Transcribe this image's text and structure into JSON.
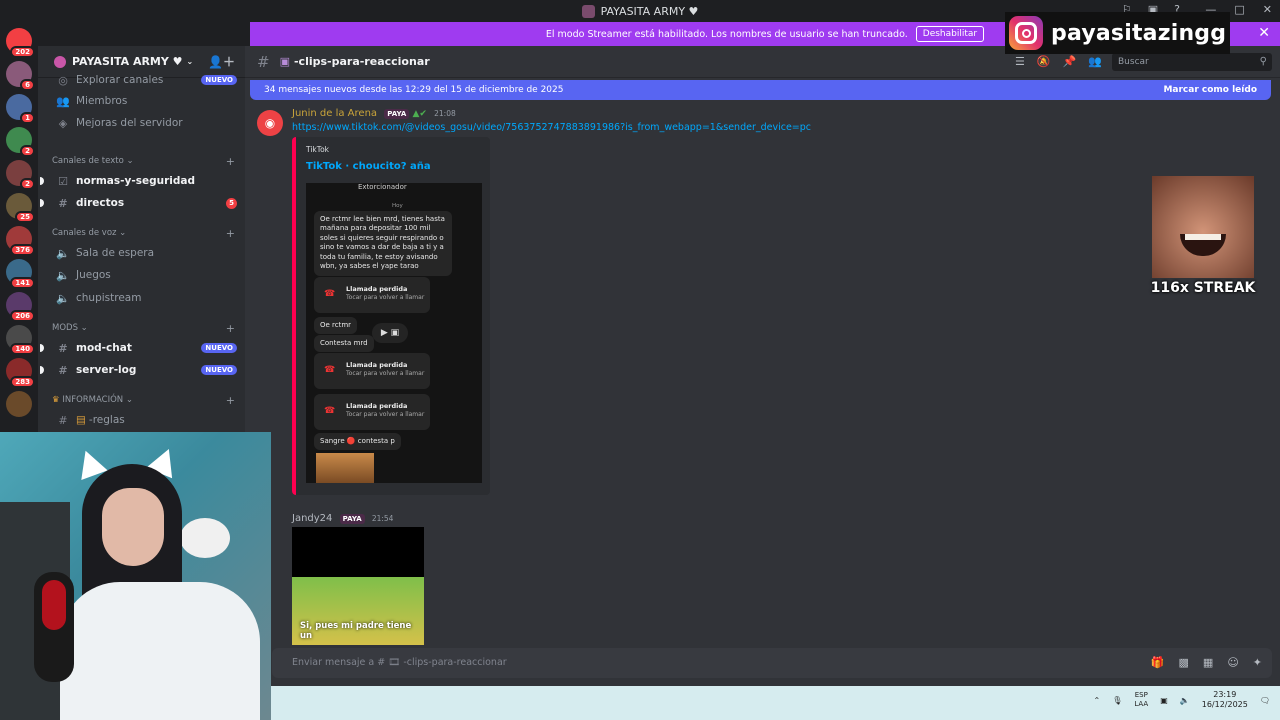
{
  "titlebar": {
    "title": "PAYASITA ARMY ♥",
    "controls": [
      "—",
      "□",
      "✕"
    ]
  },
  "streamer_bar": {
    "text": "El modo Streamer está habilitado. Los nombres de usuario se han truncado.",
    "button": "Deshabilitar",
    "close": "✕"
  },
  "overlay": {
    "handle": "payasitazingg",
    "streak": "116x STREAK"
  },
  "guilds": [
    {
      "badge": "202"
    },
    {
      "badge": "6"
    },
    {
      "badge": "1"
    },
    {
      "badge": "2"
    },
    {
      "badge": "2"
    },
    {
      "badge": "25"
    },
    {
      "badge": "376"
    },
    {
      "badge": "141"
    },
    {
      "badge": "206"
    },
    {
      "badge": "140"
    },
    {
      "badge": "283"
    },
    {
      "badge": ""
    }
  ],
  "server": {
    "name": "PAYASITA ARMY ♥"
  },
  "sidebar": {
    "top_items": [
      {
        "label": "Explorar canales",
        "pill": "NUEVO"
      },
      {
        "label": "Miembros"
      },
      {
        "label": "Mejoras del servidor"
      }
    ],
    "categories": {
      "text": "Canales de texto",
      "voice": "Canales de voz",
      "mods": "MODS",
      "info": "INFORMACIÓN"
    },
    "text_channels": [
      {
        "label": "normas-y-seguridad"
      },
      {
        "label": "directos",
        "badge": "5"
      }
    ],
    "voice_channels": [
      {
        "label": "Sala de espera"
      },
      {
        "label": "Juegos"
      },
      {
        "label": "chupistream"
      }
    ],
    "mod_channels": [
      {
        "label": "mod-chat",
        "pill": "NUEVO"
      },
      {
        "label": "server-log",
        "pill": "NUEVO"
      }
    ],
    "info_channels": [
      {
        "label": "-reglas"
      }
    ]
  },
  "channel": {
    "name": "-clips-para-reaccionar",
    "search_placeholder": "Buscar"
  },
  "new_messages": {
    "text": "34 mensajes nuevos desde las 12:29 del 15 de diciembre de 2025",
    "action": "Marcar como leído"
  },
  "messages": [
    {
      "author": "Junin de la Arena",
      "tag": "PAYA",
      "time": "21:08",
      "link": "https://www.tiktok.com/@videos_gosu/video/7563752747883891986?is_from_webapp=1&sender_device=pc",
      "embed": {
        "provider": "TikTok",
        "title": "TikTok · choucito? aña",
        "phone": {
          "contact": "Extorcionador",
          "day": "Hoy",
          "bubble1": "Oe rctmr lee bien mrd, tienes hasta mañana para depositar 100 mil soles si quieres seguir respirando o sino te vamos a dar de baja a ti y a toda tu familia, te estoy avisando wbn, ya sabes el yape tarao",
          "missed_title": "Llamada perdida",
          "missed_sub": "Tocar para volver a llamar",
          "bubble2": "Oe rctmr",
          "bubble3": "Contesta mrd",
          "bubble4": "Sangre 🔴 contesta p"
        }
      }
    },
    {
      "author": "Jandy24",
      "tag": "PAYA",
      "time": "21:54",
      "video_subtitle": "Si, pues mi padre tiene un"
    }
  ],
  "composer": {
    "placeholder": "Enviar mensaje a # 🎞 -clips-para-reaccionar"
  },
  "taskbar": {
    "lang1": "ESP",
    "lang2": "LAA",
    "time": "23:19",
    "date": "16/12/2025"
  }
}
